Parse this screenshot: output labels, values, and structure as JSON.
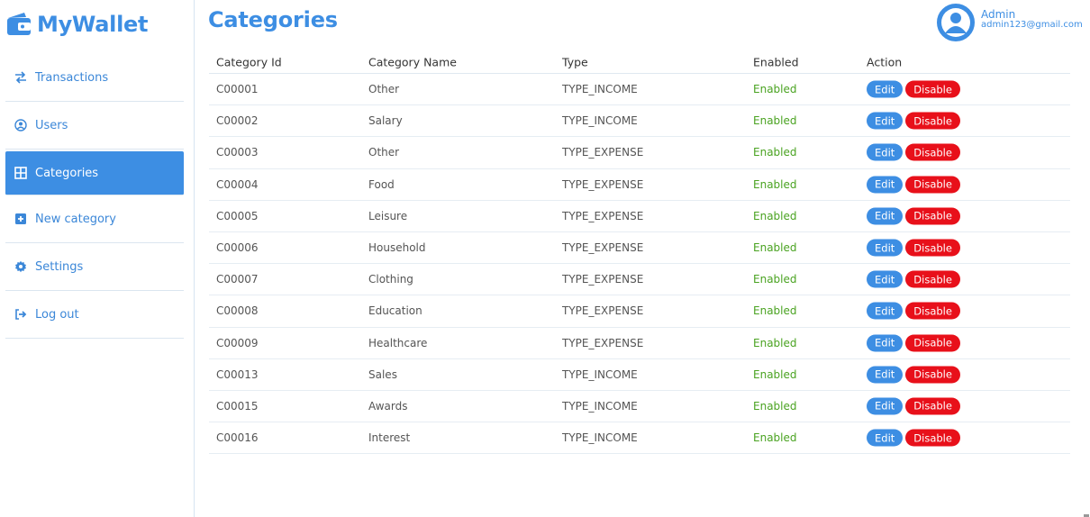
{
  "app": {
    "name": "MyWallet"
  },
  "sidebar": {
    "items": [
      {
        "label": "Transactions",
        "icon": "arrows-exchange-icon",
        "active": false
      },
      {
        "label": "Users",
        "icon": "user-circle-icon",
        "active": false
      },
      {
        "label": "Categories",
        "icon": "grid-icon",
        "active": true
      },
      {
        "label": "New category",
        "icon": "plus-square-icon",
        "active": false
      },
      {
        "label": "Settings",
        "icon": "gear-icon",
        "active": false
      },
      {
        "label": "Log out",
        "icon": "logout-icon",
        "active": false
      }
    ]
  },
  "header": {
    "title": "Categories",
    "user": {
      "name": "Admin",
      "email": "admin123@gmail.com"
    }
  },
  "table": {
    "columns": [
      "Category Id",
      "Category Name",
      "Type",
      "Enabled",
      "Action"
    ],
    "rows": [
      {
        "id": "C00001",
        "name": "Other",
        "type": "TYPE_INCOME",
        "enabled": "Enabled"
      },
      {
        "id": "C00002",
        "name": "Salary",
        "type": "TYPE_INCOME",
        "enabled": "Enabled"
      },
      {
        "id": "C00003",
        "name": "Other",
        "type": "TYPE_EXPENSE",
        "enabled": "Enabled"
      },
      {
        "id": "C00004",
        "name": "Food",
        "type": "TYPE_EXPENSE",
        "enabled": "Enabled"
      },
      {
        "id": "C00005",
        "name": "Leisure",
        "type": "TYPE_EXPENSE",
        "enabled": "Enabled"
      },
      {
        "id": "C00006",
        "name": "Household",
        "type": "TYPE_EXPENSE",
        "enabled": "Enabled"
      },
      {
        "id": "C00007",
        "name": "Clothing",
        "type": "TYPE_EXPENSE",
        "enabled": "Enabled"
      },
      {
        "id": "C00008",
        "name": "Education",
        "type": "TYPE_EXPENSE",
        "enabled": "Enabled"
      },
      {
        "id": "C00009",
        "name": "Healthcare",
        "type": "TYPE_EXPENSE",
        "enabled": "Enabled"
      },
      {
        "id": "C00013",
        "name": "Sales",
        "type": "TYPE_INCOME",
        "enabled": "Enabled"
      },
      {
        "id": "C00015",
        "name": "Awards",
        "type": "TYPE_INCOME",
        "enabled": "Enabled"
      },
      {
        "id": "C00016",
        "name": "Interest",
        "type": "TYPE_INCOME",
        "enabled": "Enabled"
      }
    ],
    "actions": {
      "edit_label": "Edit",
      "disable_label": "Disable"
    }
  },
  "colors": {
    "accent": "#3d8ee3",
    "enabled": "#4aa321",
    "danger": "#e8101a"
  }
}
